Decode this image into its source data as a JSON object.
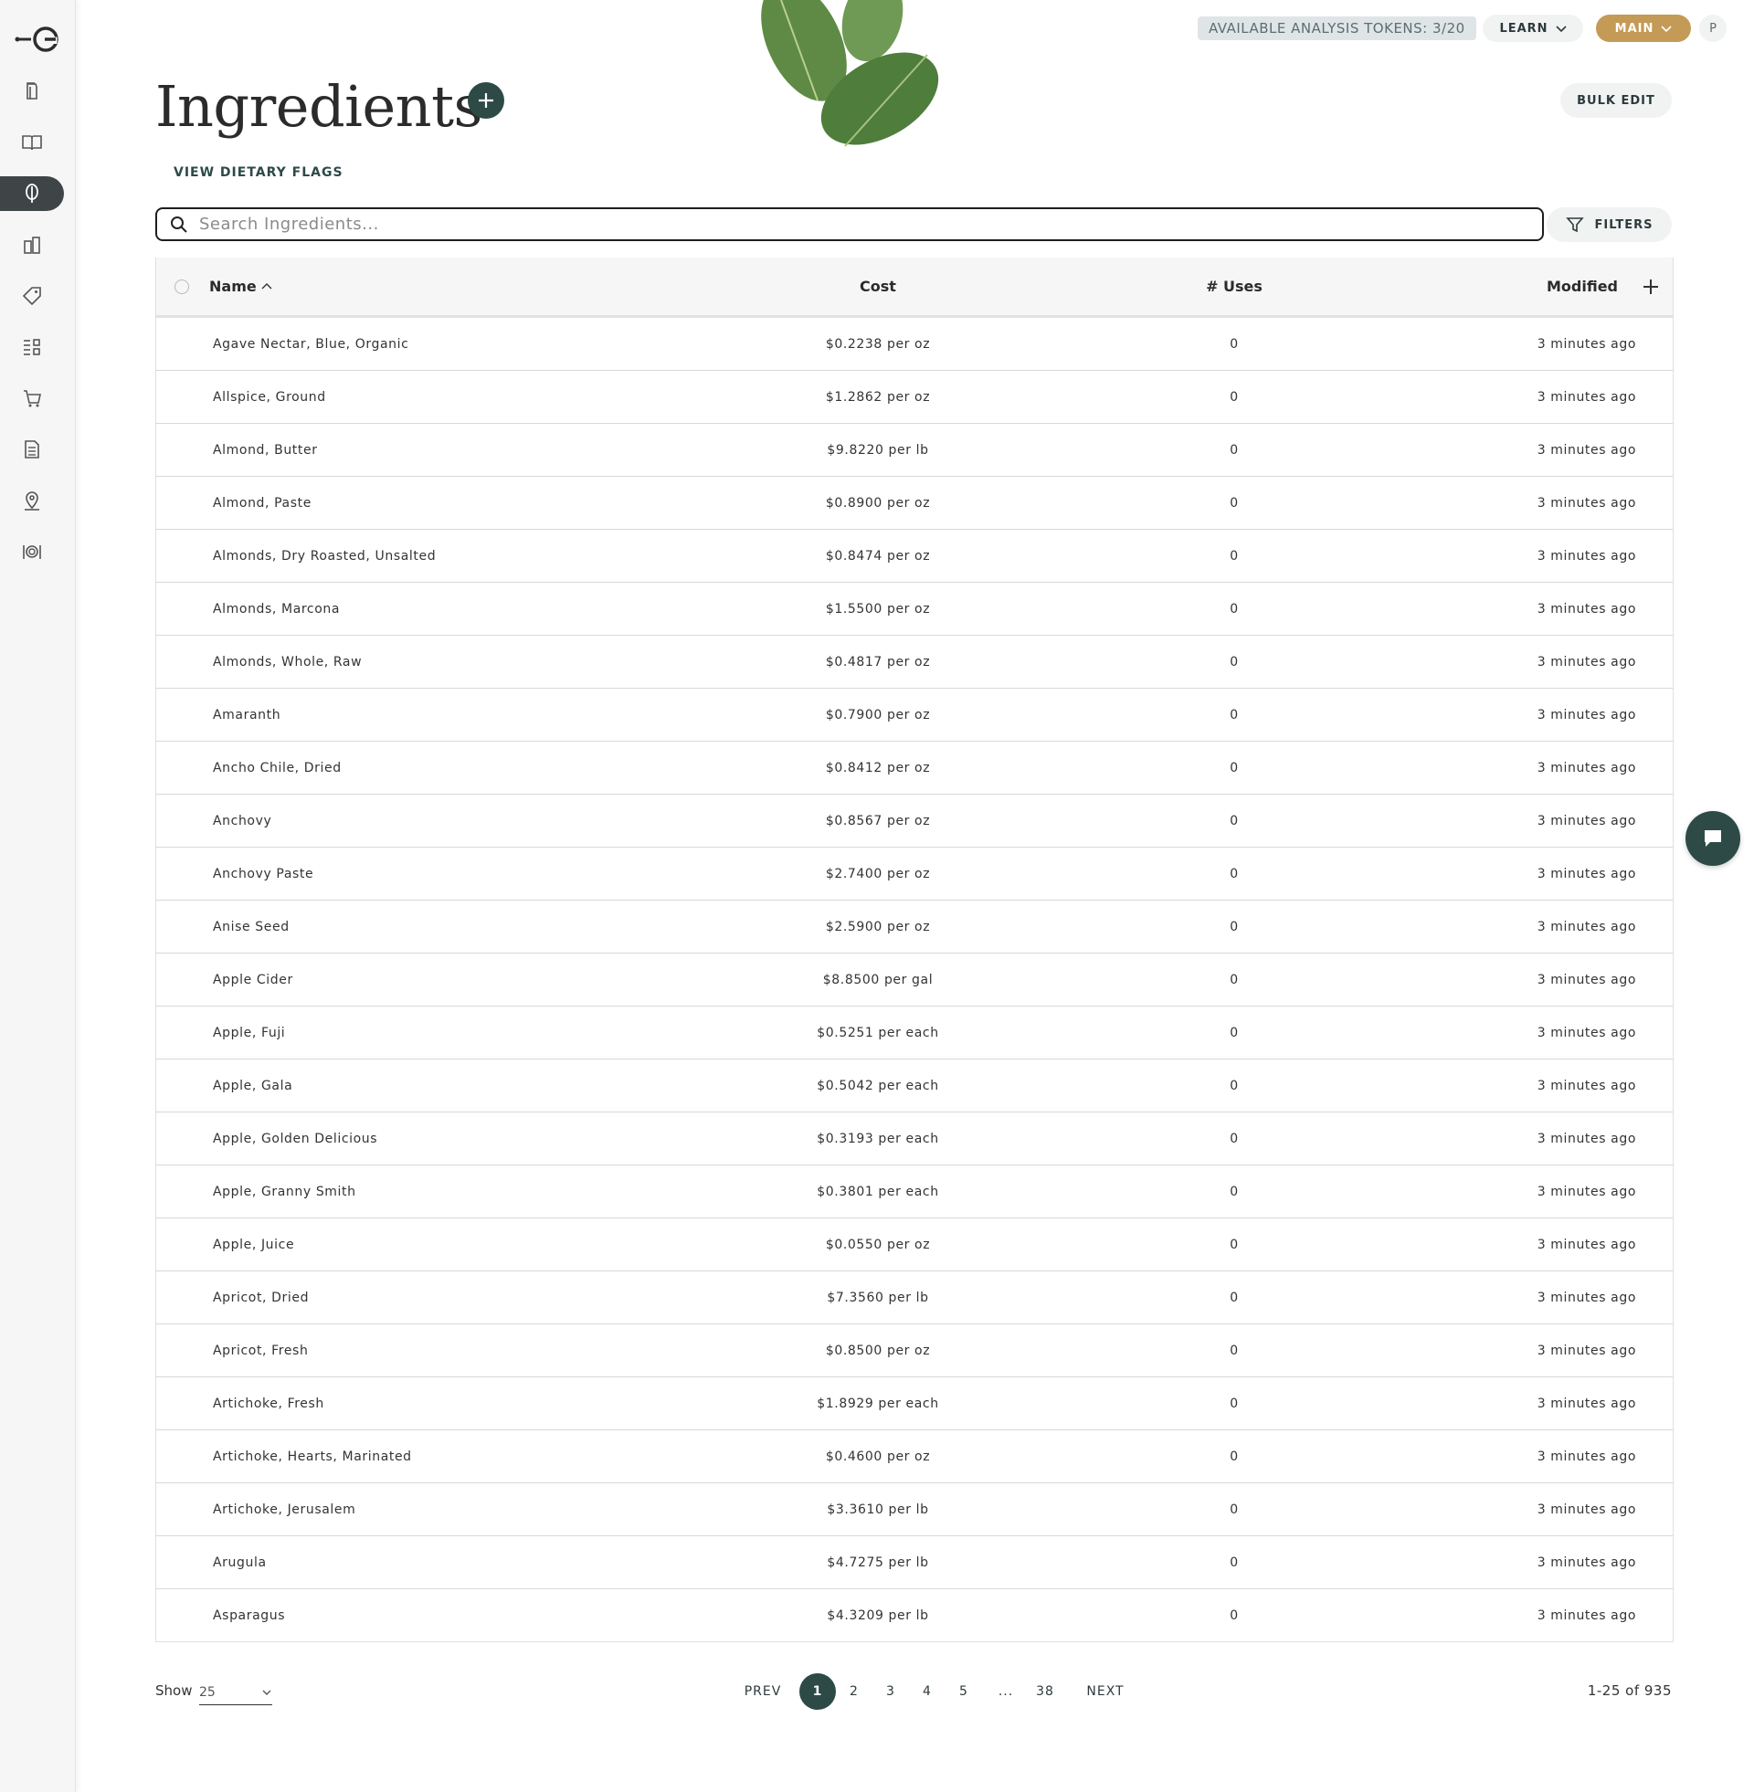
{
  "header": {
    "tokens_label": "AVAILABLE ANALYSIS TOKENS: 3/20",
    "learn_label": "LEARN",
    "main_label": "MAIN",
    "avatar_initial": "P",
    "brand_color": "#2d4a47",
    "main_color": "#c49a57"
  },
  "sidebar": {
    "items": [
      {
        "icon": "recipes-icon"
      },
      {
        "icon": "book-icon"
      },
      {
        "icon": "ingredients-icon",
        "active": true
      },
      {
        "icon": "inventory-icon"
      },
      {
        "icon": "tag-icon"
      },
      {
        "icon": "checklist-icon"
      },
      {
        "icon": "cart-icon"
      },
      {
        "icon": "document-icon"
      },
      {
        "icon": "location-icon"
      },
      {
        "icon": "menu-icon"
      }
    ]
  },
  "page": {
    "title": "Ingredients",
    "bulk_edit_label": "BULK EDIT",
    "dietary_flags_label": "VIEW DIETARY FLAGS"
  },
  "search": {
    "placeholder": "Search Ingredients...",
    "value": "",
    "filters_label": "FILTERS"
  },
  "table": {
    "columns": {
      "name": "Name",
      "cost": "Cost",
      "uses": "# Uses",
      "modified": "Modified"
    },
    "rows": [
      {
        "name": "Agave Nectar, Blue, Organic",
        "cost": "$0.2238 per oz",
        "uses": "0",
        "modified": "3 minutes ago"
      },
      {
        "name": "Allspice, Ground",
        "cost": "$1.2862 per oz",
        "uses": "0",
        "modified": "3 minutes ago"
      },
      {
        "name": "Almond, Butter",
        "cost": "$9.8220 per lb",
        "uses": "0",
        "modified": "3 minutes ago"
      },
      {
        "name": "Almond, Paste",
        "cost": "$0.8900 per oz",
        "uses": "0",
        "modified": "3 minutes ago"
      },
      {
        "name": "Almonds, Dry Roasted, Unsalted",
        "cost": "$0.8474 per oz",
        "uses": "0",
        "modified": "3 minutes ago"
      },
      {
        "name": "Almonds, Marcona",
        "cost": "$1.5500 per oz",
        "uses": "0",
        "modified": "3 minutes ago"
      },
      {
        "name": "Almonds, Whole, Raw",
        "cost": "$0.4817 per oz",
        "uses": "0",
        "modified": "3 minutes ago"
      },
      {
        "name": "Amaranth",
        "cost": "$0.7900 per oz",
        "uses": "0",
        "modified": "3 minutes ago"
      },
      {
        "name": "Ancho Chile, Dried",
        "cost": "$0.8412 per oz",
        "uses": "0",
        "modified": "3 minutes ago"
      },
      {
        "name": "Anchovy",
        "cost": "$0.8567 per oz",
        "uses": "0",
        "modified": "3 minutes ago"
      },
      {
        "name": "Anchovy Paste",
        "cost": "$2.7400 per oz",
        "uses": "0",
        "modified": "3 minutes ago"
      },
      {
        "name": "Anise Seed",
        "cost": "$2.5900 per oz",
        "uses": "0",
        "modified": "3 minutes ago"
      },
      {
        "name": "Apple Cider",
        "cost": "$8.8500 per gal",
        "uses": "0",
        "modified": "3 minutes ago"
      },
      {
        "name": "Apple, Fuji",
        "cost": "$0.5251 per each",
        "uses": "0",
        "modified": "3 minutes ago"
      },
      {
        "name": "Apple, Gala",
        "cost": "$0.5042 per each",
        "uses": "0",
        "modified": "3 minutes ago"
      },
      {
        "name": "Apple, Golden Delicious",
        "cost": "$0.3193 per each",
        "uses": "0",
        "modified": "3 minutes ago"
      },
      {
        "name": "Apple, Granny Smith",
        "cost": "$0.3801 per each",
        "uses": "0",
        "modified": "3 minutes ago"
      },
      {
        "name": "Apple, Juice",
        "cost": "$0.0550 per oz",
        "uses": "0",
        "modified": "3 minutes ago"
      },
      {
        "name": "Apricot, Dried",
        "cost": "$7.3560 per lb",
        "uses": "0",
        "modified": "3 minutes ago"
      },
      {
        "name": "Apricot, Fresh",
        "cost": "$0.8500 per oz",
        "uses": "0",
        "modified": "3 minutes ago"
      },
      {
        "name": "Artichoke, Fresh",
        "cost": "$1.8929 per each",
        "uses": "0",
        "modified": "3 minutes ago"
      },
      {
        "name": "Artichoke, Hearts, Marinated",
        "cost": "$0.4600 per oz",
        "uses": "0",
        "modified": "3 minutes ago"
      },
      {
        "name": "Artichoke, Jerusalem",
        "cost": "$3.3610 per lb",
        "uses": "0",
        "modified": "3 minutes ago"
      },
      {
        "name": "Arugula",
        "cost": "$4.7275 per lb",
        "uses": "0",
        "modified": "3 minutes ago"
      },
      {
        "name": "Asparagus",
        "cost": "$4.3209 per lb",
        "uses": "0",
        "modified": "3 minutes ago"
      }
    ]
  },
  "pagination": {
    "show_label": "Show",
    "page_size": "25",
    "prev_label": "PREV",
    "next_label": "NEXT",
    "pages": [
      "1",
      "2",
      "3",
      "4",
      "5",
      "...",
      "38"
    ],
    "current_page": "1",
    "range_label": "1-25 of 935"
  }
}
